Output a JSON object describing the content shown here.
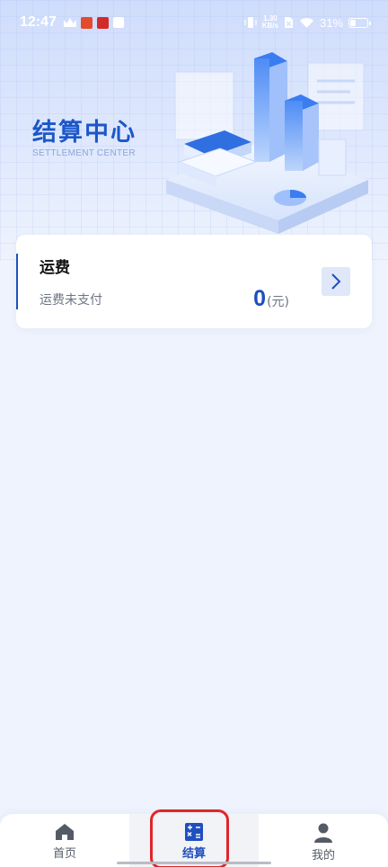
{
  "status_bar": {
    "time": "12:47",
    "net_speed_value": "1.30",
    "net_speed_unit": "KB/s",
    "battery": "31%",
    "battery_level": 0.31
  },
  "header": {
    "title": "结算中心",
    "subtitle": "SETTLEMENT CENTER"
  },
  "freight_card": {
    "title": "运费",
    "status": "运费未支付",
    "amount": "0",
    "unit": "(元)"
  },
  "tabbar": {
    "items": [
      {
        "label": "首页",
        "icon": "home-icon"
      },
      {
        "label": "结算",
        "icon": "calculator-icon",
        "active": true
      },
      {
        "label": "我的",
        "icon": "person-icon"
      }
    ]
  },
  "colors": {
    "accent": "#1f4fbf",
    "highlight": "#e0262b",
    "background": "#eef3fd"
  }
}
